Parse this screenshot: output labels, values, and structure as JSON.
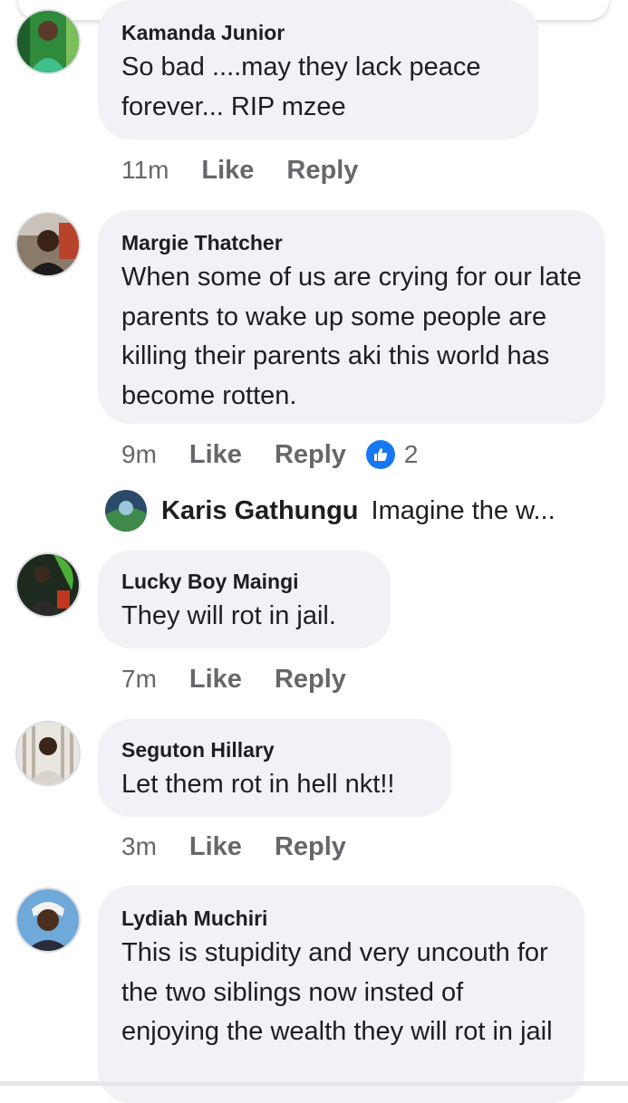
{
  "comments": [
    {
      "author": "Kamanda Junior",
      "text": "So bad ....may they lack peace forever... RIP mzee",
      "time": "11m",
      "like": "Like",
      "reply": "Reply"
    },
    {
      "author": "Margie Thatcher",
      "text": "When some of us are crying for our late parents to wake up some people are killing their parents aki this world has become rotten.",
      "time": "9m",
      "like": "Like",
      "reply": "Reply",
      "reactions": "2"
    },
    {
      "author": "Lucky Boy Maingi",
      "text": "They will rot in jail.",
      "time": "7m",
      "like": "Like",
      "reply": "Reply"
    },
    {
      "author": "Seguton Hillary",
      "text": "Let them rot in hell nkt!!",
      "time": "3m",
      "like": "Like",
      "reply": "Reply"
    },
    {
      "author": "Lydiah Muchiri",
      "text": "This is stupidity and very uncouth for the two siblings now insted of enjoying the wealth they will rot in jail"
    }
  ],
  "reply_preview": {
    "author": "Karis Gathungu",
    "text": "Imagine the w..."
  },
  "colors": {
    "bubble": "#f0f2f5",
    "secondary_text": "#65676b",
    "like_blue": "#1877f2"
  }
}
